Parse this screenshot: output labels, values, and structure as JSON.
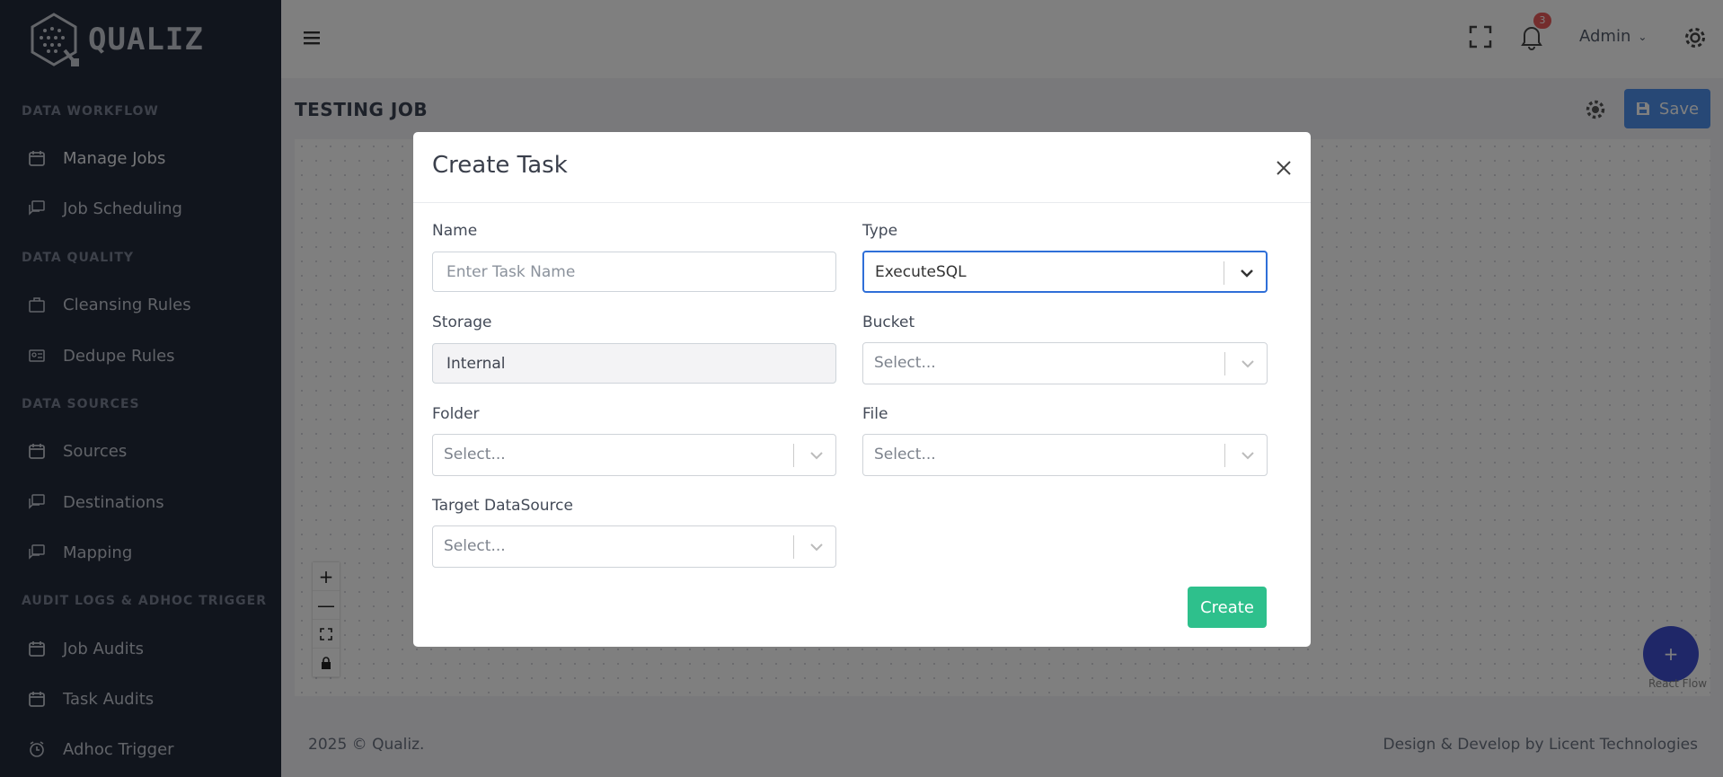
{
  "app": {
    "brand": "QUALIZ"
  },
  "sidebar": {
    "sections": [
      {
        "title": "DATA WORKFLOW",
        "items": [
          {
            "label": "Manage Jobs",
            "icon": "calendar-icon"
          },
          {
            "label": "Job Scheduling",
            "icon": "chat-icon"
          }
        ]
      },
      {
        "title": "DATA QUALITY",
        "items": [
          {
            "label": "Cleansing Rules",
            "icon": "briefcase-icon"
          },
          {
            "label": "Dedupe Rules",
            "icon": "id-card-icon"
          }
        ]
      },
      {
        "title": "DATA SOURCES",
        "items": [
          {
            "label": "Sources",
            "icon": "calendar-icon"
          },
          {
            "label": "Destinations",
            "icon": "chat-icon"
          },
          {
            "label": "Mapping",
            "icon": "chat-icon"
          }
        ]
      },
      {
        "title": "AUDIT LOGS & ADHOC TRIGGER",
        "items": [
          {
            "label": "Job Audits",
            "icon": "calendar-icon"
          },
          {
            "label": "Task Audits",
            "icon": "calendar-icon"
          },
          {
            "label": "Adhoc Trigger",
            "icon": "alarm-icon"
          }
        ]
      }
    ]
  },
  "header": {
    "notifications_count": "3",
    "user": "Admin"
  },
  "page": {
    "title": "TESTING JOB",
    "save_label": "Save"
  },
  "canvas": {
    "zoom_in": "+",
    "zoom_out": "—",
    "fab": "+",
    "attribution": "React Flow"
  },
  "footer": {
    "left": "2025 © Qualiz.",
    "right": "Design & Develop by Licent Technologies"
  },
  "modal": {
    "title": "Create Task",
    "name": {
      "label": "Name",
      "placeholder": "Enter Task Name",
      "value": ""
    },
    "type": {
      "label": "Type",
      "value": "ExecuteSQL"
    },
    "storage": {
      "label": "Storage",
      "value": "Internal"
    },
    "bucket": {
      "label": "Bucket",
      "value": "Select..."
    },
    "folder": {
      "label": "Folder",
      "value": "Select..."
    },
    "file": {
      "label": "File",
      "value": "Select..."
    },
    "target": {
      "label": "Target DataSource",
      "value": "Select..."
    },
    "create_label": "Create"
  },
  "colors": {
    "sidebar": "#232a3b",
    "primary": "#4e91ed",
    "success": "#2ec08c",
    "fab": "#3e4fd0",
    "badge": "#e85a5a"
  }
}
